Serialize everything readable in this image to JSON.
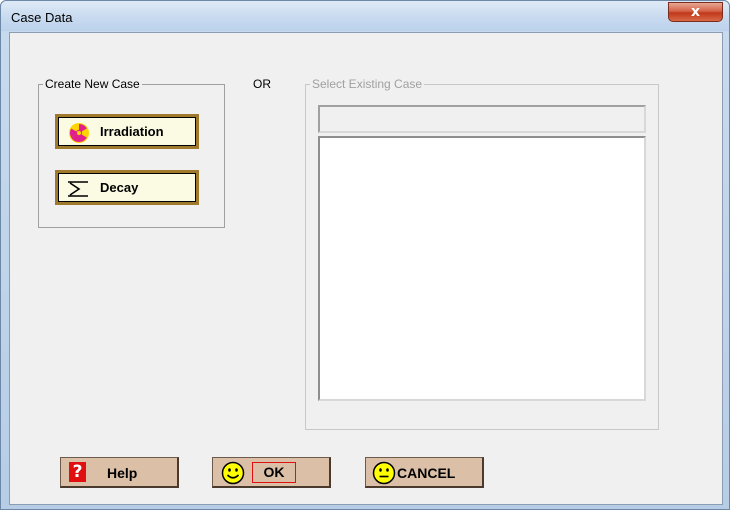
{
  "window": {
    "title": "Case Data",
    "close_label": "x"
  },
  "create_group": {
    "label": "Create New Case",
    "irradiation_label": "Irradiation",
    "decay_label": "Decay"
  },
  "or_label": "OR",
  "select_group": {
    "label": "Select Existing Case",
    "combo_value": "",
    "list_items": []
  },
  "buttons": {
    "help_label": "Help",
    "ok_label": "OK",
    "cancel_label": "CANCEL"
  },
  "colors": {
    "button_fill": "#dbbfa7",
    "case_button_fill": "#fbfbe3",
    "case_button_border": "#a07a2c",
    "ok_focus_border": "#e01010",
    "help_icon_bg": "#e01010",
    "smiley_fill": "#ffff00"
  },
  "icons": {
    "irradiation": "radiation-icon",
    "decay": "decay-sigma-icon",
    "help": "question-mark-icon",
    "ok": "smiley-icon",
    "cancel": "neutral-smiley-icon",
    "close": "close-icon"
  }
}
